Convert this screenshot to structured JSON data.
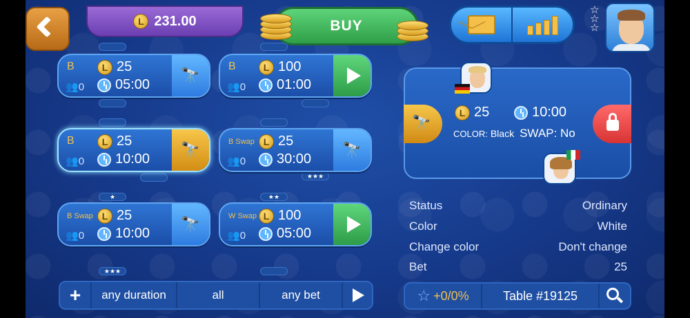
{
  "header": {
    "balance": "231.00",
    "balance_currency_icon": "L",
    "buy_label": "BUY",
    "avatar_stars": [
      "☆",
      "☆",
      "☆"
    ]
  },
  "cards": [
    {
      "type": "B",
      "bet": "25",
      "observers": "0",
      "time": "05:00",
      "action": "binoculars-icon",
      "badge": ""
    },
    {
      "type": "B",
      "bet": "100",
      "observers": "0",
      "time": "01:00",
      "action": "play-icon",
      "badge": ""
    },
    {
      "type": "B",
      "bet": "25",
      "observers": "0",
      "time": "10:00",
      "action": "binoculars-key-icon",
      "badge": ""
    },
    {
      "type": "B Swap",
      "bet": "25",
      "observers": "0",
      "time": "30:00",
      "action": "binoculars-icon",
      "badge": "★★★"
    },
    {
      "type": "B Swap",
      "bet": "25",
      "observers": "0",
      "time": "10:00",
      "action": "binoculars-icon",
      "badge": "★"
    },
    {
      "type": "W Swap",
      "bet": "100",
      "observers": "0",
      "time": "05:00",
      "action": "play-icon",
      "badge": "★★"
    }
  ],
  "extra_badge": "★★★",
  "filter": {
    "add": "+",
    "duration": "any duration",
    "kind": "all",
    "bet": "any bet"
  },
  "detail": {
    "bet": "25",
    "time": "10:00",
    "color_label": "COLOR:",
    "color_value": "Black",
    "swap": "SWAP: No",
    "player1_flag": "Germany",
    "player2_flag": "Italy"
  },
  "info": [
    {
      "label": "Status",
      "value": "Ordinary"
    },
    {
      "label": "Color",
      "value": "White"
    },
    {
      "label": "Change color",
      "value": "Don't change"
    },
    {
      "label": "Bet",
      "value": "25"
    }
  ],
  "bottom": {
    "rating": "+0/0%",
    "table": "Table #19125"
  },
  "colors": {
    "background": "#1a4396",
    "buy": "#3cb55a",
    "accent_gold": "#f0c050",
    "lock": "#e84848"
  }
}
